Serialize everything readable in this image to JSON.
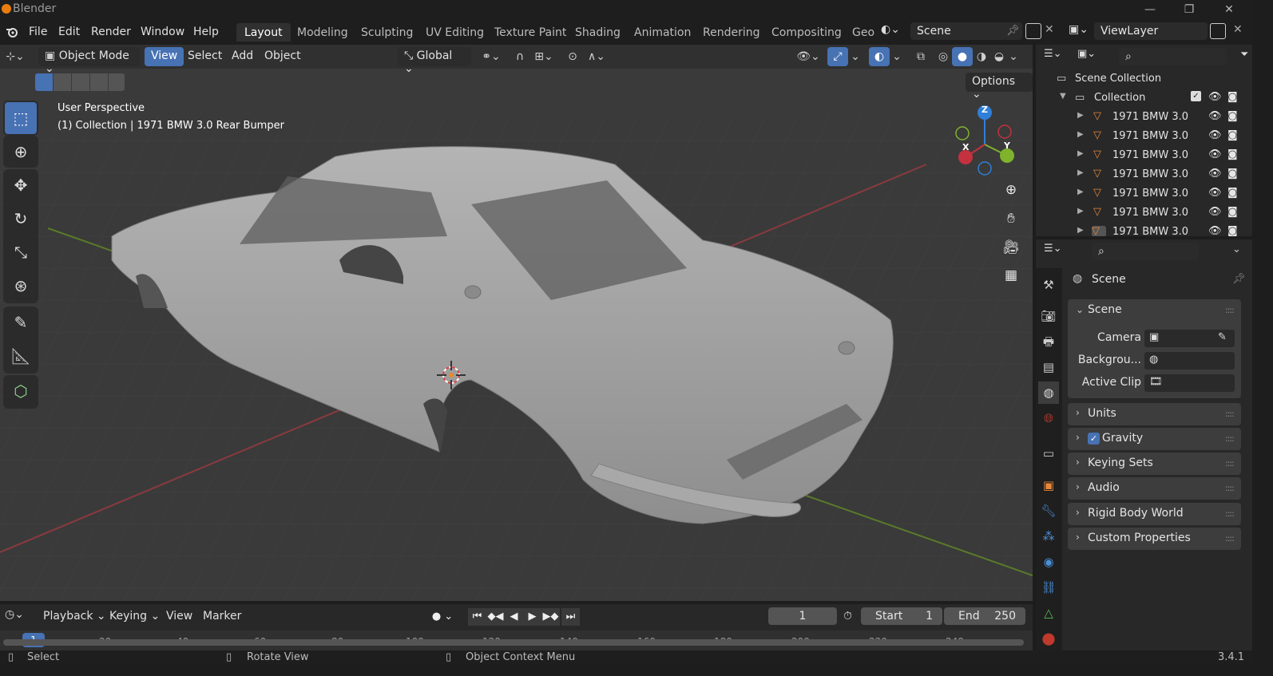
{
  "window": {
    "title": "Blender",
    "minimize": "—",
    "maximize": "❐",
    "close": "✕"
  },
  "menu": {
    "file": "File",
    "edit": "Edit",
    "render": "Render",
    "window": "Window",
    "help": "Help"
  },
  "workspaces": [
    "Layout",
    "Modeling",
    "Sculpting",
    "UV Editing",
    "Texture Paint",
    "Shading",
    "Animation",
    "Rendering",
    "Compositing",
    "Geo"
  ],
  "active_workspace": "Layout",
  "scene_field": "Scene",
  "viewlayer_field": "ViewLayer",
  "viewport": {
    "mode": "Object Mode",
    "menus": {
      "view": "View",
      "select": "Select",
      "add": "Add",
      "object": "Object"
    },
    "transform_orientation": "Global",
    "options": "Options",
    "overlay_title": "User Perspective",
    "overlay_subtitle": "(1) Collection | 1971 BMW 3.0 Rear Bumper",
    "gizmo": {
      "z": "Z",
      "y": "Y",
      "x": "X"
    }
  },
  "outliner": {
    "root": "Scene Collection",
    "collection": "Collection",
    "items": [
      "1971 BMW 3.0",
      "1971 BMW 3.0",
      "1971 BMW 3.0",
      "1971 BMW 3.0",
      "1971 BMW 3.0",
      "1971 BMW 3.0",
      "1971 BMW 3.0"
    ]
  },
  "properties": {
    "header": "Scene",
    "panel_scene": {
      "title": "Scene",
      "camera_label": "Camera",
      "background_label": "Backgrou...",
      "active_clip_label": "Active Clip"
    },
    "panels": [
      "Units",
      "Gravity",
      "Keying Sets",
      "Audio",
      "Rigid Body World",
      "Custom Properties"
    ],
    "gravity_enabled": true
  },
  "timeline": {
    "menus": {
      "playback": "Playback",
      "keying": "Keying",
      "view": "View",
      "marker": "Marker"
    },
    "current_frame": "1",
    "start_label": "Start",
    "start": "1",
    "end_label": "End",
    "end": "250",
    "ticks": [
      "1",
      "20",
      "40",
      "60",
      "80",
      "100",
      "120",
      "140",
      "160",
      "180",
      "200",
      "220",
      "240"
    ]
  },
  "status": {
    "select": "Select",
    "rotate": "Rotate View",
    "context": "Object Context Menu",
    "version": "3.4.1"
  },
  "colors": {
    "accent": "#4772b3",
    "x_axis": "#c4313f",
    "y_axis": "#7fb32c",
    "z_axis": "#2f7fd8",
    "mesh": "#e0883d",
    "brand": "#e87d0d"
  }
}
